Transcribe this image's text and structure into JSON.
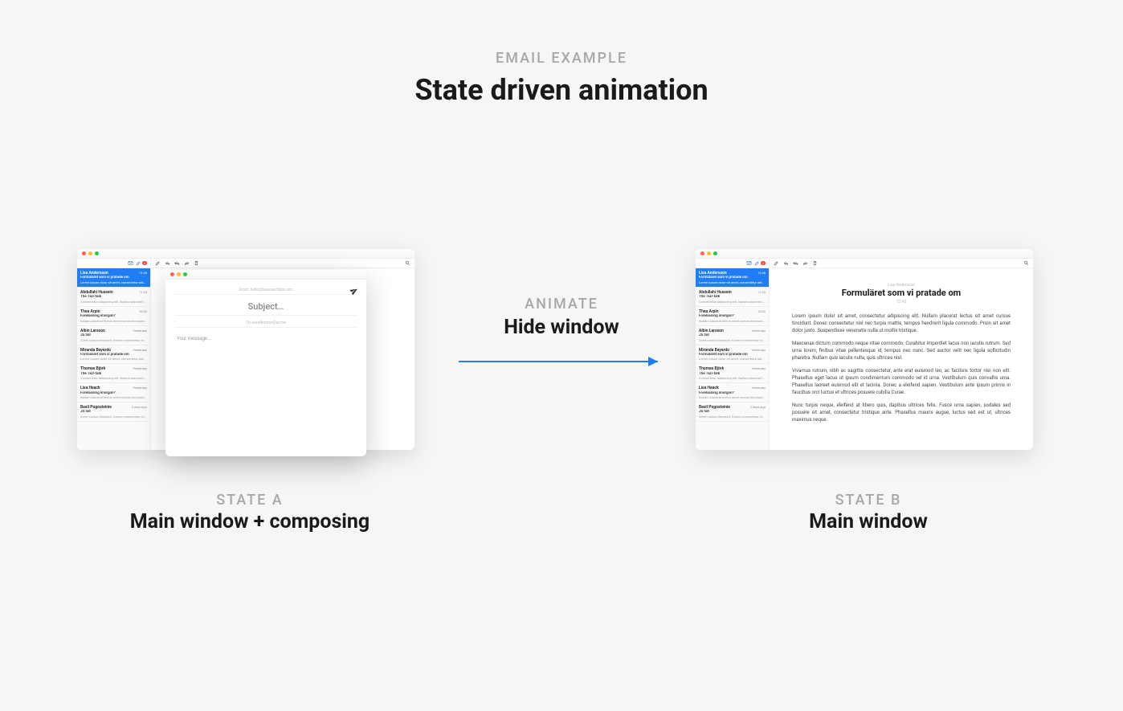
{
  "header": {
    "kicker": "EMAIL EXAMPLE",
    "title": "State driven animation"
  },
  "center": {
    "kicker": "ANIMATE",
    "title": "Hide window"
  },
  "captionA": {
    "kicker": "STATE A",
    "title": "Main window + composing"
  },
  "captionB": {
    "kicker": "STATE B",
    "title": "Main window"
  },
  "compose": {
    "from": "From: hello@laeasentilijus.om",
    "subject_placeholder": "Subject…",
    "to": "To: kundkontor@acme",
    "body_placeholder": "Your message…"
  },
  "reading": {
    "sender": "Lisa Andersson",
    "subject": "Formuläret som vi pratade om",
    "time": "12.45",
    "paragraphs": [
      "Lorem ipsum dolor sit amet, consectetur adipiscing elit. Nullam placerat lectus sit amet cursus tincidunt. Donec consectetur nisl nec turpis mattis, tempus hendrerit ligula commodo. Proin sit amet dolor justo. Suspendisse venenatis nulla ut mollis tristique.",
      "Maecenas dictum commodo neque vitae commodo. Curabitur imperdiet lacus non iaculis rutrum. Sed urna lorem, finibus vitae pellentesque id, tempus nec nunc. Sed auctor velit nec ligula sollicitudin pharetra. Nullam quis iaculis nulla, quis ultrices nisl.",
      "Vivamus rutrum, nibh ac sagittis consectetur, ante erat euismod leo, ac facilisis tortor nisi non elit. Phasellus eget lacus ut ipsum condimentum commodo vel id urna. Vestibulum quis convallis urna. Phasellus laoreet euismod elit et lacinia. Donec a eleifend sapien. Vestibulum ante ipsum primis in faucibus orci luctus et ultrices posuere cubilia Curae.",
      "Nunc turpis neque, eleifend at libero quis, dapibus ultrices felis. Fusce urna sapien, sodales sed posuere sit amet, consectetur tristique ante. Phasellus mauris augue, luctus sed est ut, ultrices maximus neque."
    ]
  },
  "messages": [
    {
      "from": "Lisa Andersson",
      "time": "12:46",
      "subject": "Formuläret som vi pratade om",
      "preview": "Lorem ipsum dolor sit amet, consectetur adipiscing elit. Nullam placerat lectus …",
      "selected": true
    },
    {
      "from": "Abdullahi Hussein",
      "time": "11:34",
      "subject": "The TED-talk",
      "preview": "Consectetur adipiscing elit. Nullam placerat lectus amet tempor tincidunt. Donec …"
    },
    {
      "from": "Thea Arpin",
      "time": "10:02",
      "subject": "Föreläsning imorgon?",
      "preview": "Nullam placerat lectus amet cursus tincidunt in laeter nec laorem placerat …"
    },
    {
      "from": "Albin Larsson",
      "time": "Yesterday",
      "subject": "JS fall",
      "preview": "Amet cursus tincidunt. Donec consectetur nisl nec turpis mattis, tempor hendrerit …"
    },
    {
      "from": "Miranda Bayardo",
      "time": "Yesterday",
      "subject": "Formuläret som vi pratade om",
      "preview": "Lorem ipsum dolor sit amet, consectetur adipiscing elit. Nullam placerat lectus …"
    },
    {
      "from": "Thomas Björk",
      "time": "Yesterday",
      "subject": "The TED-talk",
      "preview": "Consectetur adipiscing elit. Nullam placerat lectus amet tempor tincidunt. Donec …"
    },
    {
      "from": "Lisa Haack",
      "time": "Yesterday",
      "subject": "Föreläsning imorgon?",
      "preview": "Nullam placerat lectus amet cursus tincidunt in laeter nec …"
    },
    {
      "from": "Basil Pogosteinie",
      "time": "2 days ago",
      "subject": "JS fall",
      "preview": "Amet cursus tincidunt. Donec consectetur nisl nec turpis mattis, tempor hendrerit …"
    }
  ]
}
